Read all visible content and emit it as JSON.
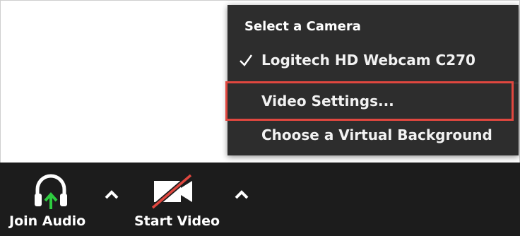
{
  "camera_menu": {
    "header": "Select a Camera",
    "items": [
      {
        "label": "Logitech HD Webcam C270",
        "checked": true
      },
      {
        "label": "Video Settings...",
        "highlighted": true
      },
      {
        "label": "Choose a Virtual Background"
      }
    ]
  },
  "toolbar": {
    "join_audio_label": "Join Audio",
    "start_video_label": "Start Video"
  },
  "icons": {
    "audio": "headphones-icon",
    "video": "video-camera-off-icon",
    "caret": "chevron-up-icon",
    "check": "checkmark-icon"
  },
  "colors": {
    "toolbar_bg": "#1c1c1c",
    "menu_bg": "#2d2d2d",
    "highlight_border": "#e0473f",
    "audio_arrow": "#2ecc40",
    "video_slash": "#e0473f"
  }
}
